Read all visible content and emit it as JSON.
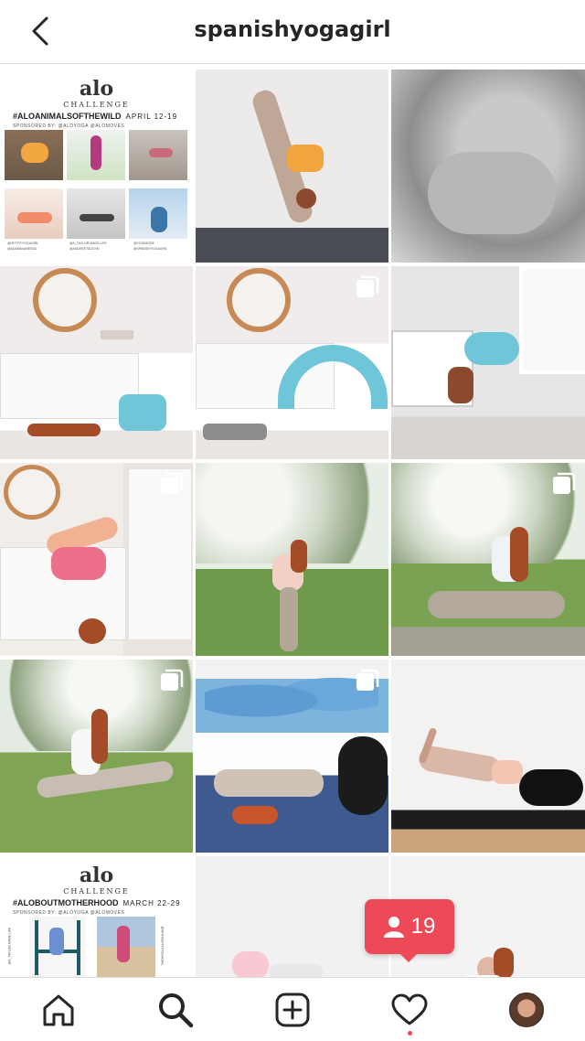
{
  "header": {
    "title": "spanishyogagirl"
  },
  "posts": [
    {
      "kind": "poster",
      "logo": "alo",
      "subtitle": "CHALLENGE",
      "hashtag": "#ALOANIMALSOFTHEWILD",
      "date": "APRIL 12-19",
      "sponsor": "SPONSORED BY: @ALOYOGA @ALOMOVES",
      "handles": [
        "@GETFITYOGAGIRL",
        "@ADAMAVANESSA",
        "@A_TAYLOR.MADE.LIFE",
        "@ANDREETALEVIN",
        "@YOGIMODE",
        "@SPANISHYOGAGIRL"
      ]
    },
    {
      "kind": "photo",
      "multi": false
    },
    {
      "kind": "photo",
      "multi": false
    },
    {
      "kind": "photo",
      "multi": false
    },
    {
      "kind": "photo",
      "multi": true
    },
    {
      "kind": "photo",
      "multi": false
    },
    {
      "kind": "photo",
      "multi": true
    },
    {
      "kind": "photo",
      "multi": false
    },
    {
      "kind": "photo",
      "multi": true
    },
    {
      "kind": "photo",
      "multi": true
    },
    {
      "kind": "photo",
      "multi": true
    },
    {
      "kind": "photo",
      "multi": false
    },
    {
      "kind": "poster",
      "logo": "alo",
      "subtitle": "CHALLENGE",
      "hashtag": "#ALOBOUTMOTHERHOOD",
      "date": "MARCH 22-29",
      "sponsor": "SPONSORED BY: @ALOYOGA @ALOMOVES",
      "handles": [
        "@A_TAYLOR.MADE.LIFE",
        "@WITHGETFITYOGAGIRL"
      ]
    },
    {
      "kind": "photo",
      "multi": false
    },
    {
      "kind": "photo",
      "multi": false
    }
  ],
  "notification_badge": {
    "icon": "follower-icon",
    "count": "19",
    "color": "#ed4956"
  },
  "tabbar": {
    "items": [
      "home-icon",
      "search-icon",
      "new-post-icon",
      "activity-heart-icon",
      "profile-avatar"
    ],
    "active": "search-icon"
  }
}
